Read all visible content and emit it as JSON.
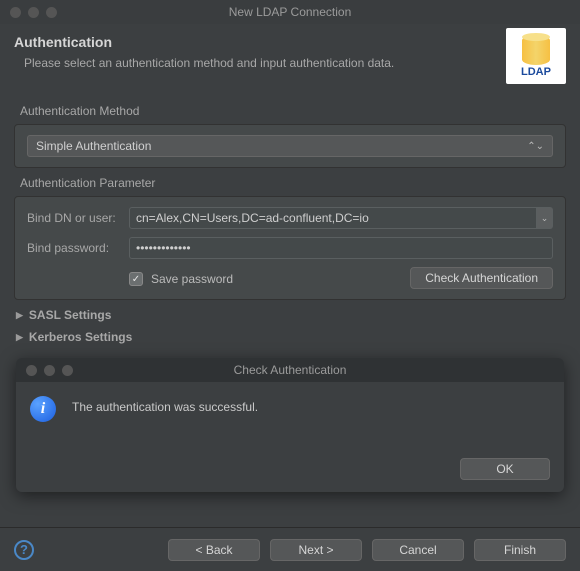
{
  "window": {
    "title": "New LDAP Connection"
  },
  "header": {
    "title": "Authentication",
    "subtitle": "Please select an authentication method and input authentication data.",
    "icon_label": "LDAP"
  },
  "auth_method": {
    "section_label": "Authentication Method",
    "selected": "Simple Authentication"
  },
  "auth_param": {
    "section_label": "Authentication Parameter",
    "bind_dn_label": "Bind DN or user:",
    "bind_dn_value": "cn=Alex,CN=Users,DC=ad-confluent,DC=io",
    "bind_pw_label": "Bind password:",
    "bind_pw_mask": "•••••••••••••",
    "save_pw_label": "Save password",
    "save_pw_checked": true,
    "check_auth_btn": "Check Authentication"
  },
  "collapsibles": {
    "sasl": "SASL Settings",
    "kerberos": "Kerberos Settings"
  },
  "dialog": {
    "title": "Check Authentication",
    "message": "The authentication was successful.",
    "ok": "OK"
  },
  "footer": {
    "back": "< Back",
    "next": "Next >",
    "cancel": "Cancel",
    "finish": "Finish"
  }
}
